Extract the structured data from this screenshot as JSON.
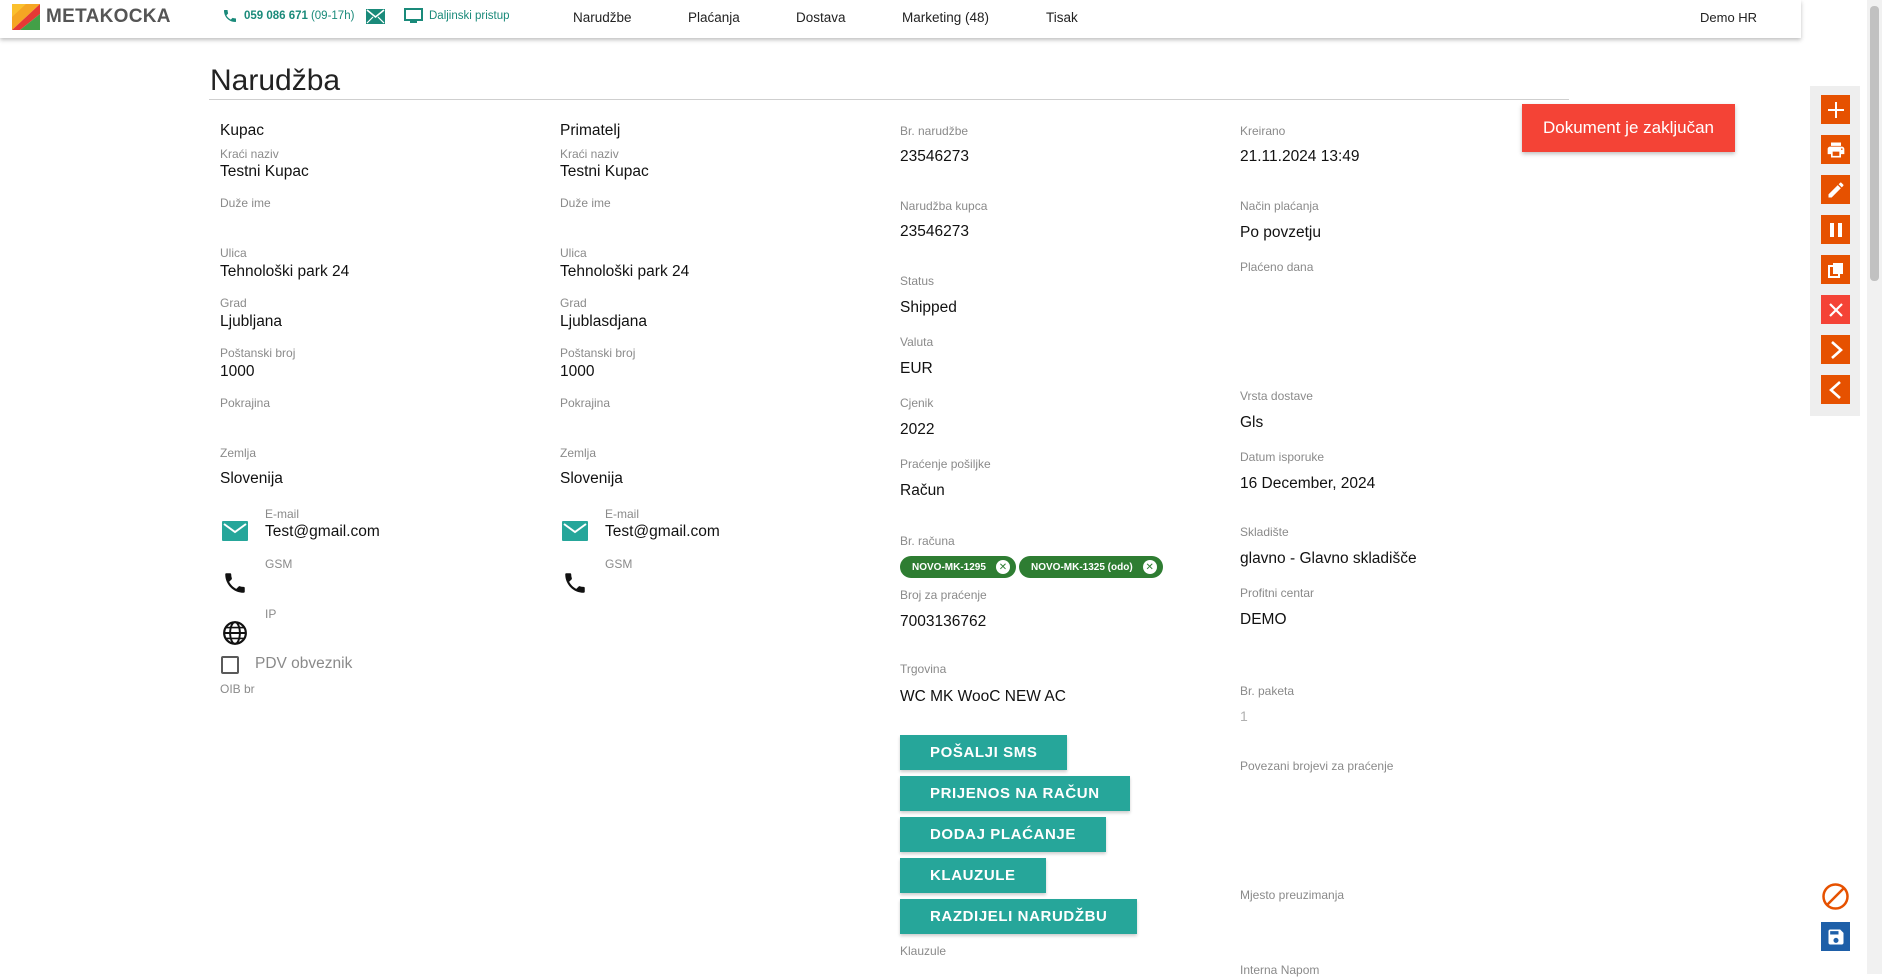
{
  "brand": {
    "name": "METAKOCKA"
  },
  "contact": {
    "phone": "059 086 671",
    "hours": "(09-17h)",
    "remote": "Daljinski pristup"
  },
  "nav": {
    "orders": "Narudžbe",
    "payments": "Plaćanja",
    "delivery": "Dostava",
    "marketing": "Marketing (48)",
    "print": "Tisak"
  },
  "user": "Demo HR",
  "page": {
    "title": "Narudžba",
    "locked": "Dokument je zaključan"
  },
  "buyer": {
    "header": "Kupac",
    "short_name_label": "Kraći naziv",
    "short_name": "Testni Kupac",
    "long_name_label": "Duže ime",
    "street_label": "Ulica",
    "street": "Tehnološki park 24",
    "city_label": "Grad",
    "city": "Ljubljana",
    "zip_label": "Poštanski broj",
    "zip": "1000",
    "province_label": "Pokrajina",
    "country_label": "Zemlja",
    "country": "Slovenija",
    "email_label": "E-mail",
    "email": "Test@gmail.com",
    "gsm_label": "GSM",
    "ip_label": "IP",
    "vat_label": "PDV obveznik",
    "oib_label": "OIB br"
  },
  "recipient": {
    "header": "Primatelj",
    "short_name_label": "Kraći naziv",
    "short_name": "Testni Kupac",
    "long_name_label": "Duže ime",
    "street_label": "Ulica",
    "street": "Tehnološki park 24",
    "city_label": "Grad",
    "city": "Ljublasdjana",
    "zip_label": "Poštanski broj",
    "zip": "1000",
    "province_label": "Pokrajina",
    "country_label": "Zemlja",
    "country": "Slovenija",
    "email_label": "E-mail",
    "email": "Test@gmail.com",
    "gsm_label": "GSM"
  },
  "order": {
    "number_label": "Br. narudžbe",
    "number": "23546273",
    "customer_order_label": "Narudžba kupca",
    "customer_order": "23546273",
    "status_label": "Status",
    "status": "Shipped",
    "currency_label": "Valuta",
    "currency": "EUR",
    "pricelist_label": "Cjenik",
    "pricelist": "2022",
    "tracking_label": "Praćenje pošiljke",
    "tracking": "Račun",
    "invoice_label": "Br. računa",
    "invoice_chips": [
      "NOVO-MK-1295",
      "NOVO-MK-1325 (odo)"
    ],
    "tracking_no_label": "Broj za praćenje",
    "tracking_no": "7003136762",
    "shop_label": "Trgovina",
    "shop": "WC MK WooC NEW AC",
    "clauses_label": "Klauzule"
  },
  "actions": {
    "send_sms": "POŠALJI SMS",
    "to_invoice": "PRIJENOS NA RAČUN",
    "add_payment": "DODAJ PLAĆANJE",
    "clauses": "KLAUZULE",
    "split_order": "RAZDIJELI NARUDŽBU"
  },
  "details": {
    "created_label": "Kreirano",
    "created": "21.11.2024 13:49",
    "payment_method_label": "Način plaćanja",
    "payment_method": "Po povzetju",
    "paid_days_label": "Plaćeno dana",
    "delivery_type_label": "Vrsta dostave",
    "delivery_type": "Gls",
    "delivery_date_label": "Datum isporuke",
    "delivery_date": "16 December, 2024",
    "warehouse_label": "Skladište",
    "warehouse": "glavno - Glavno skladišče",
    "profit_center_label": "Profitni centar",
    "profit_center": "DEMO",
    "packages_label": "Br. paketa",
    "packages": "1",
    "linked_tracking_label": "Povezani brojevi za praćenje",
    "pickup_label": "Mjesto preuzimanja",
    "internal_note_label": "Interna Napom"
  },
  "colors": {
    "accent": "#26a69a",
    "toolbar": "#e65100",
    "danger": "#f44336",
    "chip": "#2e7d32",
    "save": "#1e5fa8"
  }
}
